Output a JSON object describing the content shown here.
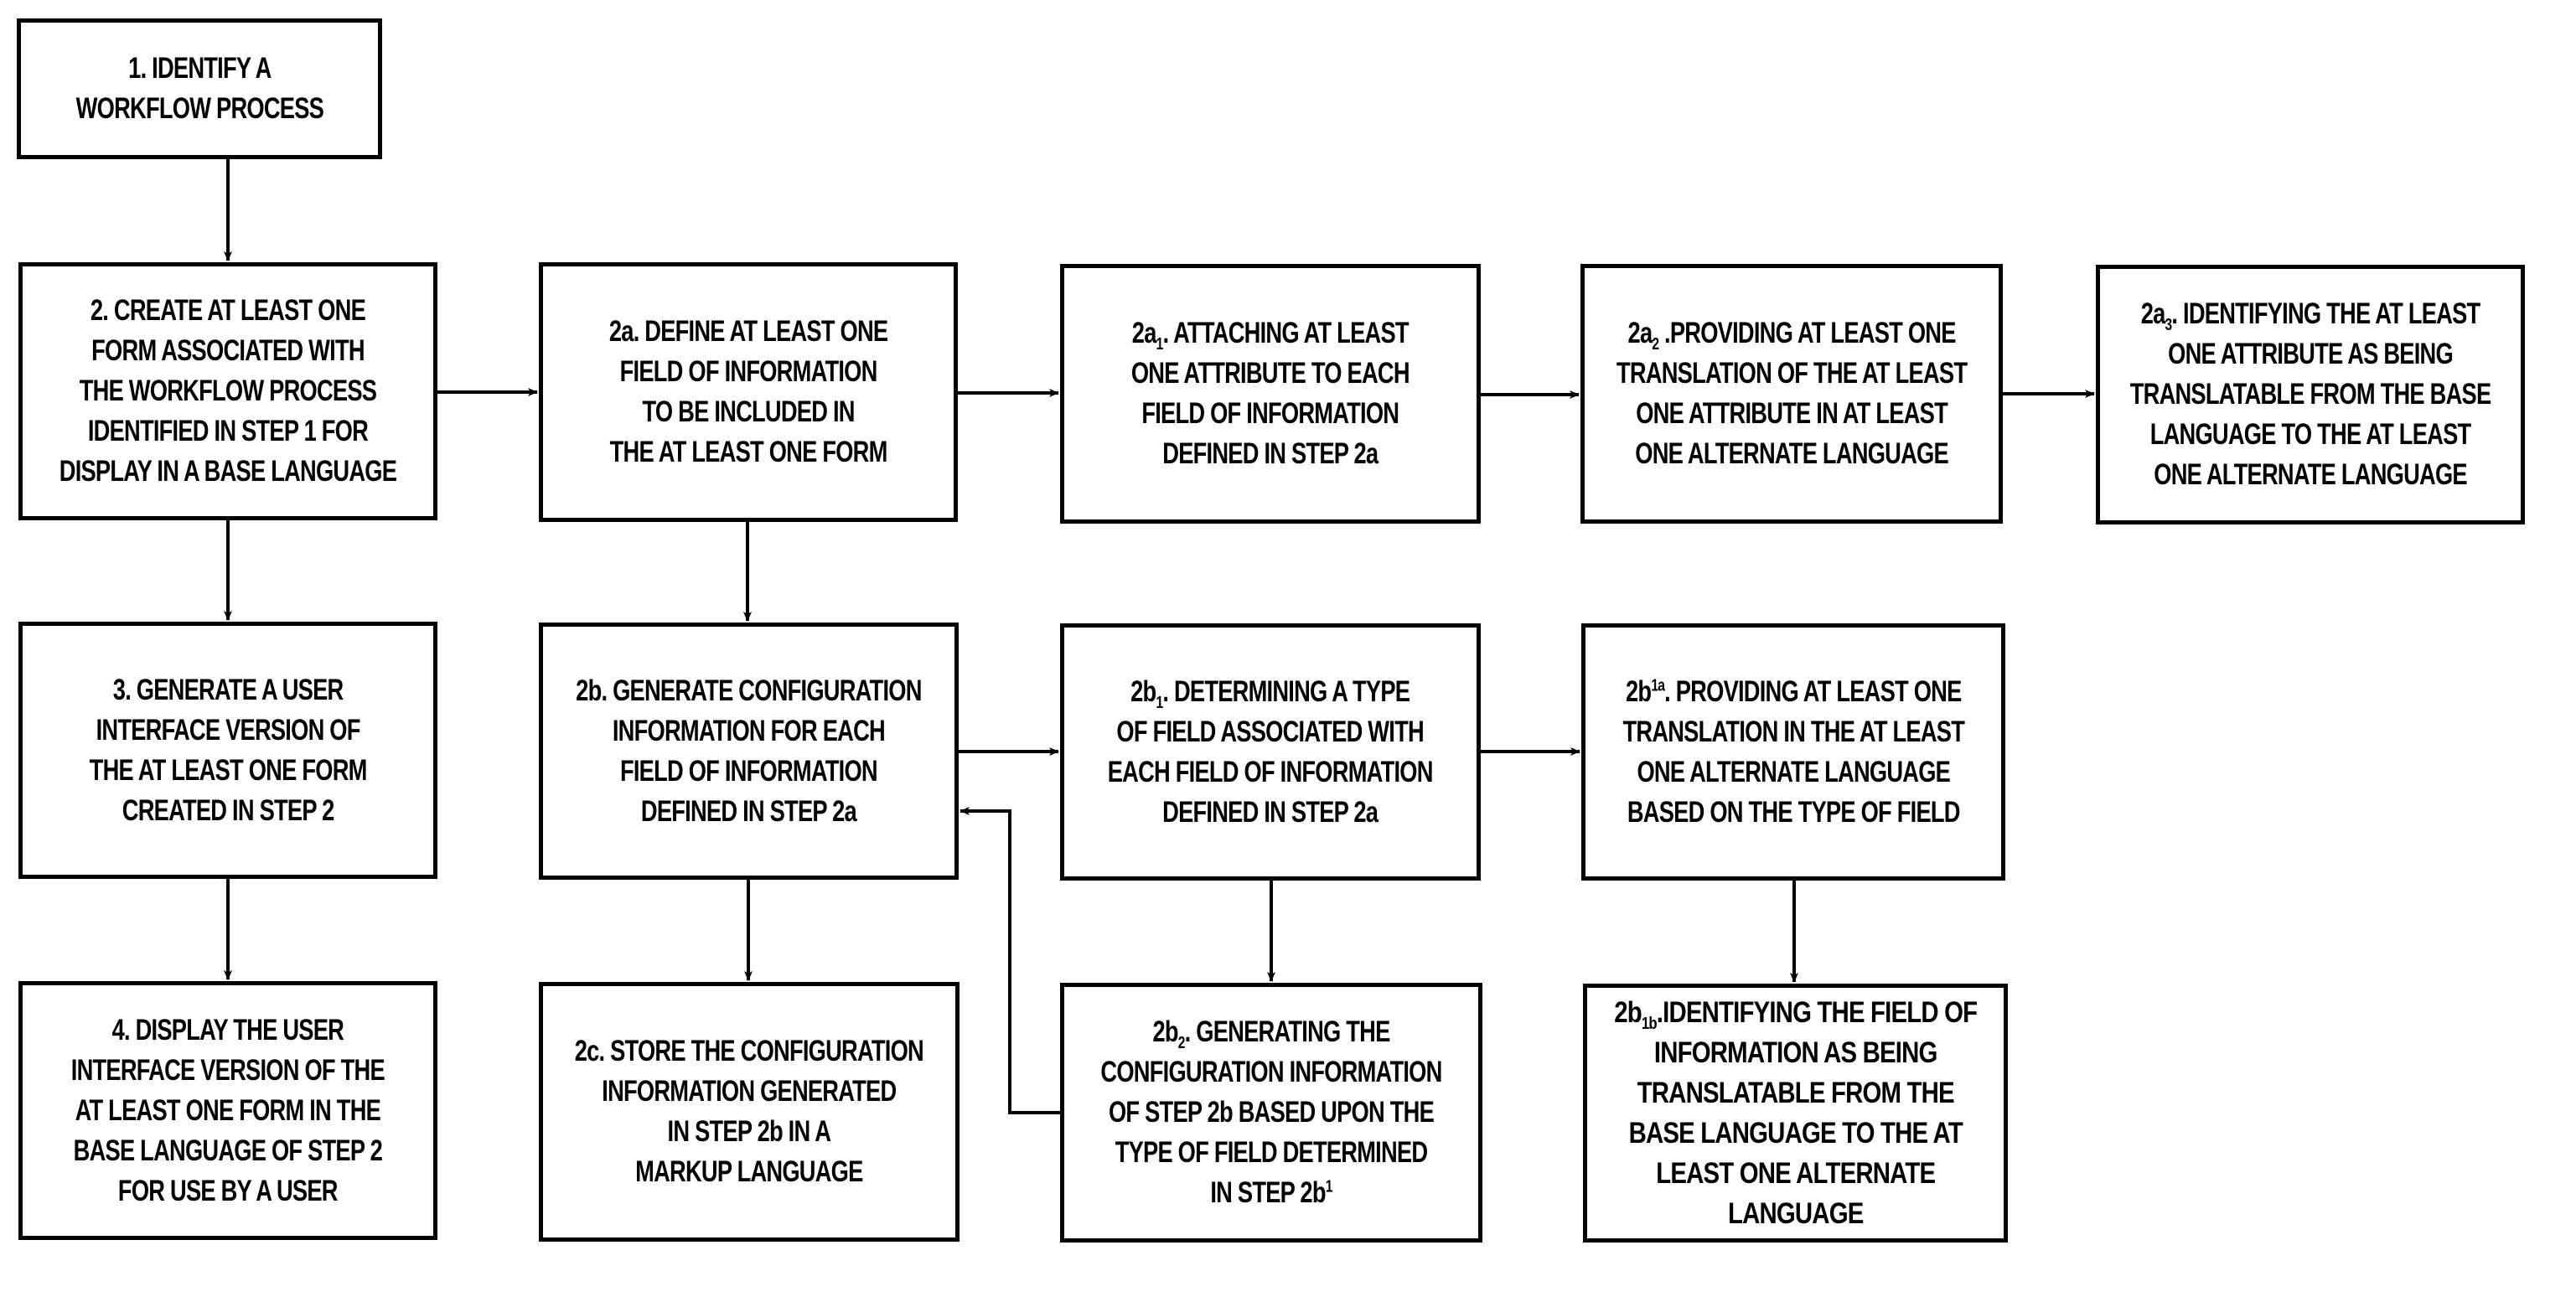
{
  "diagram": {
    "type": "flowchart",
    "colors": {
      "stroke": "#000000",
      "fill": "#ffffff",
      "text": "#000000"
    },
    "nodes": [
      {
        "id": "1",
        "label_lines": [
          "1.  IDENTIFY A",
          "WORKFLOW PROCESS"
        ]
      },
      {
        "id": "2",
        "label_lines": [
          "2.  CREATE AT LEAST ONE",
          "FORM ASSOCIATED WITH",
          "THE WORKFLOW PROCESS",
          "IDENTIFIED IN STEP 1 FOR",
          "DISPLAY IN A BASE LANGUAGE"
        ]
      },
      {
        "id": "2a",
        "label_lines": [
          "2a.  DEFINE AT LEAST ONE",
          "FIELD OF INFORMATION",
          "TO BE INCLUDED IN",
          "THE AT LEAST ONE FORM"
        ]
      },
      {
        "id": "2a1",
        "prefix": "2a",
        "sub": "1",
        "first_rest": ". ATTACHING AT LEAST",
        "label_lines": [
          "ONE ATTRIBUTE TO EACH",
          "FIELD OF INFORMATION",
          "DEFINED IN STEP 2a"
        ]
      },
      {
        "id": "2a2",
        "prefix": "2a",
        "sub": "2",
        "first_rest": " .PROVIDING AT LEAST ONE",
        "label_lines": [
          "TRANSLATION OF THE AT LEAST",
          "ONE ATTRIBUTE IN AT LEAST",
          "ONE ALTERNATE LANGUAGE"
        ]
      },
      {
        "id": "2a3",
        "prefix": "2a",
        "sub": "3",
        "first_rest": ". IDENTIFYING THE AT LEAST",
        "label_lines": [
          "ONE ATTRIBUTE AS BEING",
          "TRANSLATABLE FROM THE BASE",
          "LANGUAGE TO THE AT LEAST",
          "ONE ALTERNATE LANGUAGE"
        ]
      },
      {
        "id": "3",
        "label_lines": [
          "3.  GENERATE A USER",
          "INTERFACE VERSION OF",
          "THE AT LEAST ONE FORM",
          "CREATED IN STEP 2"
        ]
      },
      {
        "id": "2b",
        "label_lines": [
          "2b. GENERATE CONFIGURATION",
          "INFORMATION FOR EACH",
          "FIELD OF INFORMATION",
          "DEFINED IN STEP 2a"
        ]
      },
      {
        "id": "2b1",
        "prefix": "2b",
        "sub": "1",
        "first_rest": ". DETERMINING A TYPE",
        "label_lines": [
          "OF FIELD ASSOCIATED WITH",
          "EACH FIELD OF INFORMATION",
          "DEFINED IN STEP 2a"
        ]
      },
      {
        "id": "2b1a",
        "prefix": "2b",
        "sup": "1a",
        "first_rest": ". PROVIDING AT LEAST ONE",
        "label_lines": [
          "TRANSLATION IN THE AT LEAST",
          "ONE ALTERNATE LANGUAGE",
          "BASED ON THE TYPE OF FIELD"
        ]
      },
      {
        "id": "4",
        "label_lines": [
          "4.  DISPLAY THE USER",
          "INTERFACE VERSION OF THE",
          "AT LEAST ONE FORM IN THE",
          "BASE LANGUAGE OF STEP 2",
          "FOR USE BY A USER"
        ]
      },
      {
        "id": "2c",
        "label_lines": [
          "2c. STORE THE CONFIGURATION",
          "INFORMATION GENERATED",
          "IN STEP 2b IN A",
          "MARKUP LANGUAGE"
        ]
      },
      {
        "id": "2b2",
        "prefix": "2b",
        "sub": "2",
        "first_rest": ". GENERATING THE",
        "label_lines": [
          "CONFIGURATION INFORMATION",
          "OF STEP 2b BASED UPON THE",
          "TYPE OF FIELD DETERMINED"
        ],
        "last_prefix": "IN STEP 2b",
        "last_sup": "1"
      },
      {
        "id": "2b1b",
        "prefix": "2b",
        "sub": "1b",
        "first_rest": ".IDENTIFYING THE FIELD OF",
        "label_lines": [
          "INFORMATION AS BEING",
          "TRANSLATABLE FROM THE",
          "BASE LANGUAGE TO THE AT",
          "LEAST ONE ALTERNATE",
          "LANGUAGE"
        ]
      }
    ],
    "edges": [
      {
        "from": "1",
        "to": "2"
      },
      {
        "from": "2",
        "to": "2a"
      },
      {
        "from": "2a",
        "to": "2a1"
      },
      {
        "from": "2a1",
        "to": "2a2"
      },
      {
        "from": "2a2",
        "to": "2a3"
      },
      {
        "from": "2",
        "to": "3"
      },
      {
        "from": "2a",
        "to": "2b"
      },
      {
        "from": "2b",
        "to": "2b1"
      },
      {
        "from": "2b1",
        "to": "2b1a"
      },
      {
        "from": "3",
        "to": "4"
      },
      {
        "from": "2b",
        "to": "2c"
      },
      {
        "from": "2b1",
        "to": "2b2"
      },
      {
        "from": "2b1a",
        "to": "2b1b"
      },
      {
        "from": "2b2",
        "to": "2b"
      }
    ]
  }
}
